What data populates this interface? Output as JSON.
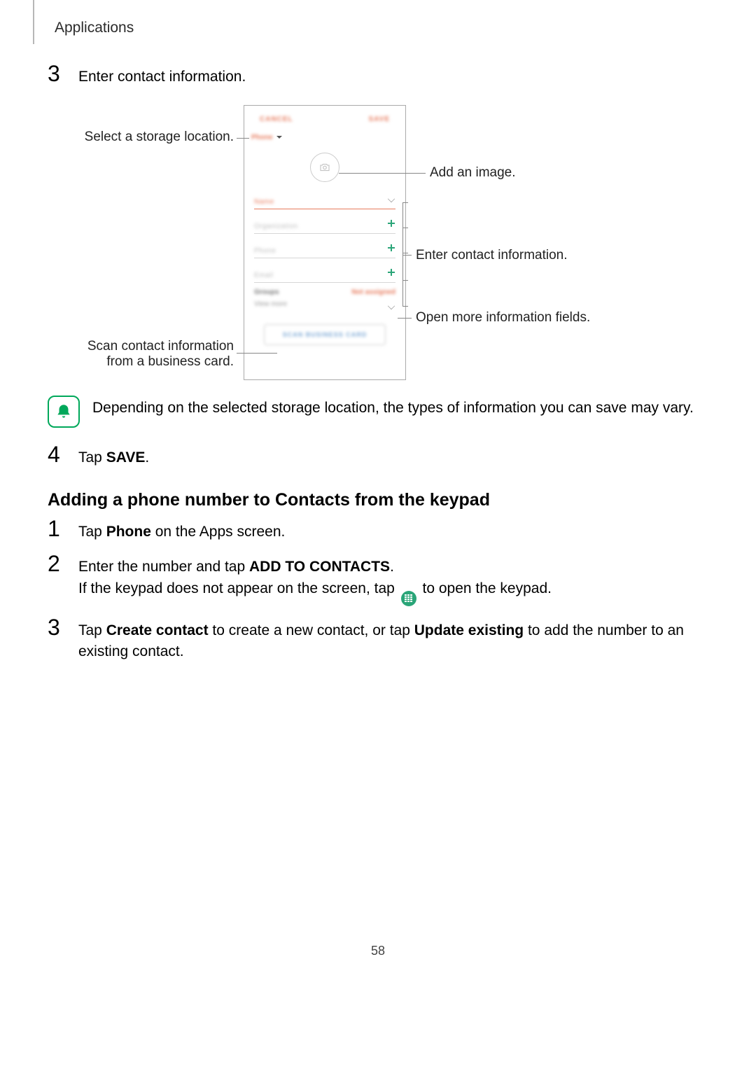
{
  "header": "Applications",
  "page_number": "58",
  "step3": {
    "num": "3",
    "text": "Enter contact information."
  },
  "diagram": {
    "left_storage": "Select a storage location.",
    "left_scan": "Scan contact information from a business card.",
    "right_image": "Add an image.",
    "right_info": "Enter contact information.",
    "right_more": "Open more information fields.",
    "screen": {
      "cancel": "CANCEL",
      "save": "SAVE",
      "storage": "Phone",
      "f_name": "Name",
      "f_org": "Organization",
      "f_phone": "Phone",
      "f_email": "Email",
      "groups": "Groups",
      "notassigned": "Not assigned",
      "viewmore": "View more",
      "scanbtn": "SCAN BUSINESS CARD"
    }
  },
  "note": "Depending on the selected storage location, the types of information you can save may vary.",
  "step4": {
    "num": "4",
    "pre": "Tap ",
    "bold": "SAVE",
    "post": "."
  },
  "subheading": "Adding a phone number to Contacts from the keypad",
  "k1": {
    "num": "1",
    "pre": "Tap ",
    "bold": "Phone",
    "post": " on the Apps screen."
  },
  "k2": {
    "num": "2",
    "l1_pre": "Enter the number and tap ",
    "l1_bold": "ADD TO CONTACTS",
    "l1_post": ".",
    "l2_pre": "If the keypad does not appear on the screen, tap ",
    "l2_post": " to open the keypad."
  },
  "k3": {
    "num": "3",
    "pre": "Tap ",
    "b1": "Create contact",
    "mid": " to create a new contact, or tap ",
    "b2": "Update existing",
    "post": " to add the number to an existing contact."
  }
}
